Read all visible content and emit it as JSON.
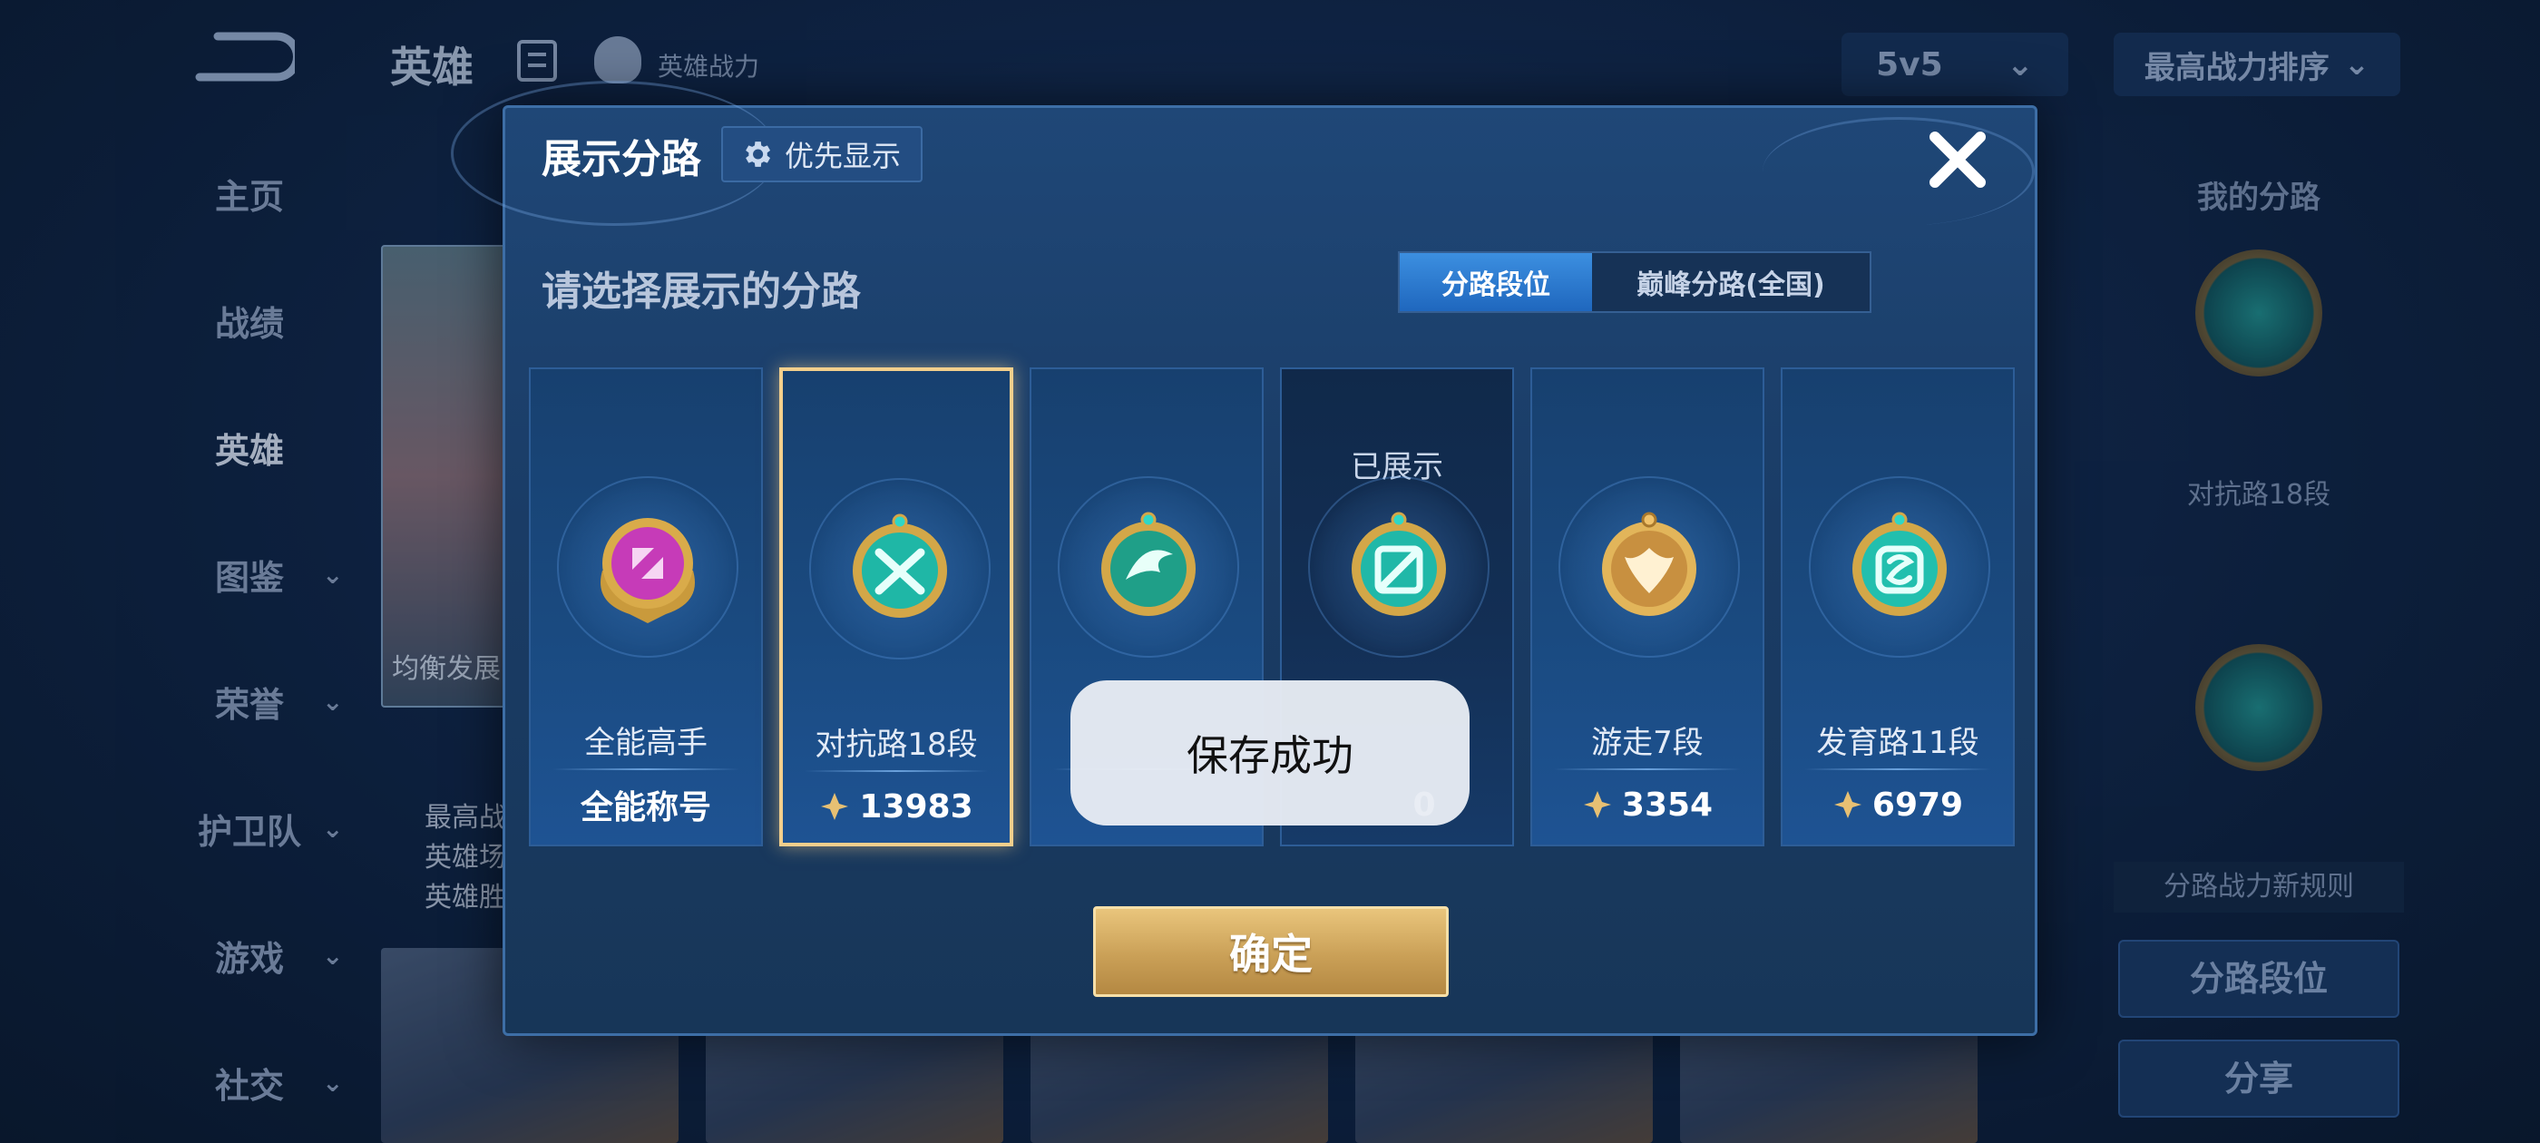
{
  "background": {
    "top_title": "英雄",
    "top_subtitle": "英雄战力",
    "mode_select": "5v5",
    "sort_select": "最高战力排序",
    "nav_items": [
      {
        "label": "主页",
        "chevron": false
      },
      {
        "label": "战绩",
        "chevron": false
      },
      {
        "label": "英雄",
        "chevron": false,
        "active": true
      },
      {
        "label": "图鉴",
        "chevron": true
      },
      {
        "label": "荣誉",
        "chevron": true
      },
      {
        "label": "护卫队",
        "chevron": true
      },
      {
        "label": "游戏",
        "chevron": true
      },
      {
        "label": "社交",
        "chevron": true
      }
    ],
    "hero_card_tag": "均衡发展",
    "hero_info": [
      "最高战",
      "英雄场",
      "英雄胜"
    ],
    "right_panel": {
      "title": "我的分路",
      "badge_label": "对抗路18段",
      "rule": "分路战力新规则",
      "lane_rank_button": "分路段位",
      "share_button": "分享"
    }
  },
  "modal": {
    "title": "展示分路",
    "priority_button": "优先显示",
    "subtitle": "请选择展示的分路",
    "tabs": {
      "lane_rank": "分路段位",
      "peak_lane": "巅峰分路(全国)"
    },
    "cards": [
      {
        "name": "全能高手",
        "value": "全能称号",
        "shown_label": "",
        "emblem": "allround-emblem",
        "color": "#c63bb8"
      },
      {
        "name": "对抗路18段",
        "value": "13983",
        "shown_label": "",
        "emblem": "clash-lane-emblem",
        "color": "#1fb7a6",
        "selected": true
      },
      {
        "name": "",
        "value": "",
        "shown_label": "",
        "emblem": "jungle-emblem",
        "color": "#1f9f88"
      },
      {
        "name": "",
        "value": "0",
        "shown_label": "已展示",
        "emblem": "mid-lane-emblem",
        "color": "#20b8a8"
      },
      {
        "name": "游走7段",
        "value": "3354",
        "shown_label": "",
        "emblem": "roam-emblem",
        "color": "#c89040"
      },
      {
        "name": "发育路11段",
        "value": "6979",
        "shown_label": "",
        "emblem": "farm-lane-emblem",
        "color": "#22bfae"
      }
    ],
    "confirm_button": "确定",
    "toast": "保存成功"
  }
}
